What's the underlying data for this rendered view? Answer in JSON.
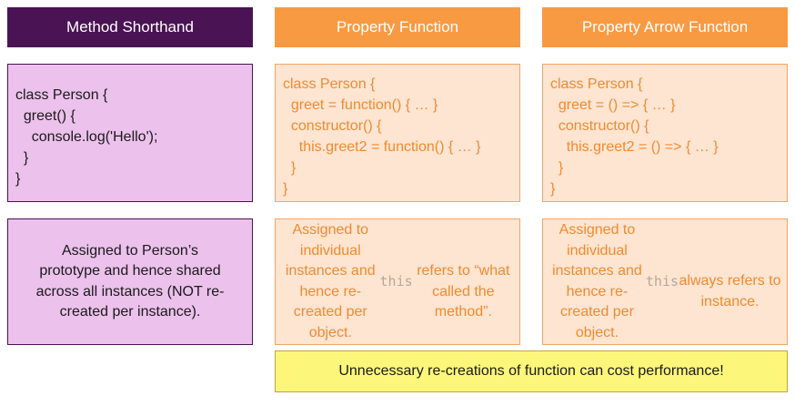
{
  "columns": [
    {
      "header": "Method Shorthand",
      "code": "class Person {\n  greet() {\n    console.log('Hello');\n  }\n}",
      "desc": [
        "Assigned to Person’s",
        "prototype and hence shared",
        "across all instances (NOT re-",
        "created per instance)."
      ]
    },
    {
      "header": "Property Function",
      "code": "class Person {\n  greet = function() { … }\n  constructor() {\n    this.greet2 = function() { … }\n  }\n}",
      "desc_pre": "Assigned to individual\ninstances and hence re-\ncreated per object. ",
      "desc_code": "this",
      "desc_post": "\nrefers to “what called the\nmethod”."
    },
    {
      "header": "Property Arrow Function",
      "code": "class Person {\n  greet = () => { … }\n  constructor() {\n    this.greet2 = () => { … }\n  }\n}",
      "desc_pre": "Assigned to individual\ninstances and hence re-\ncreated per object. ",
      "desc_code": "this",
      "desc_post": "\nalways refers to instance."
    }
  ],
  "note": "Unnecessary re-creations of function can cost performance!",
  "colors": {
    "purple_dark": "#4a1353",
    "purple_light": "#ecc1ec",
    "orange": "#f89a42",
    "orange_light": "#fde5d2",
    "orange_text": "#f08a2e",
    "yellow": "#fcf77a"
  }
}
